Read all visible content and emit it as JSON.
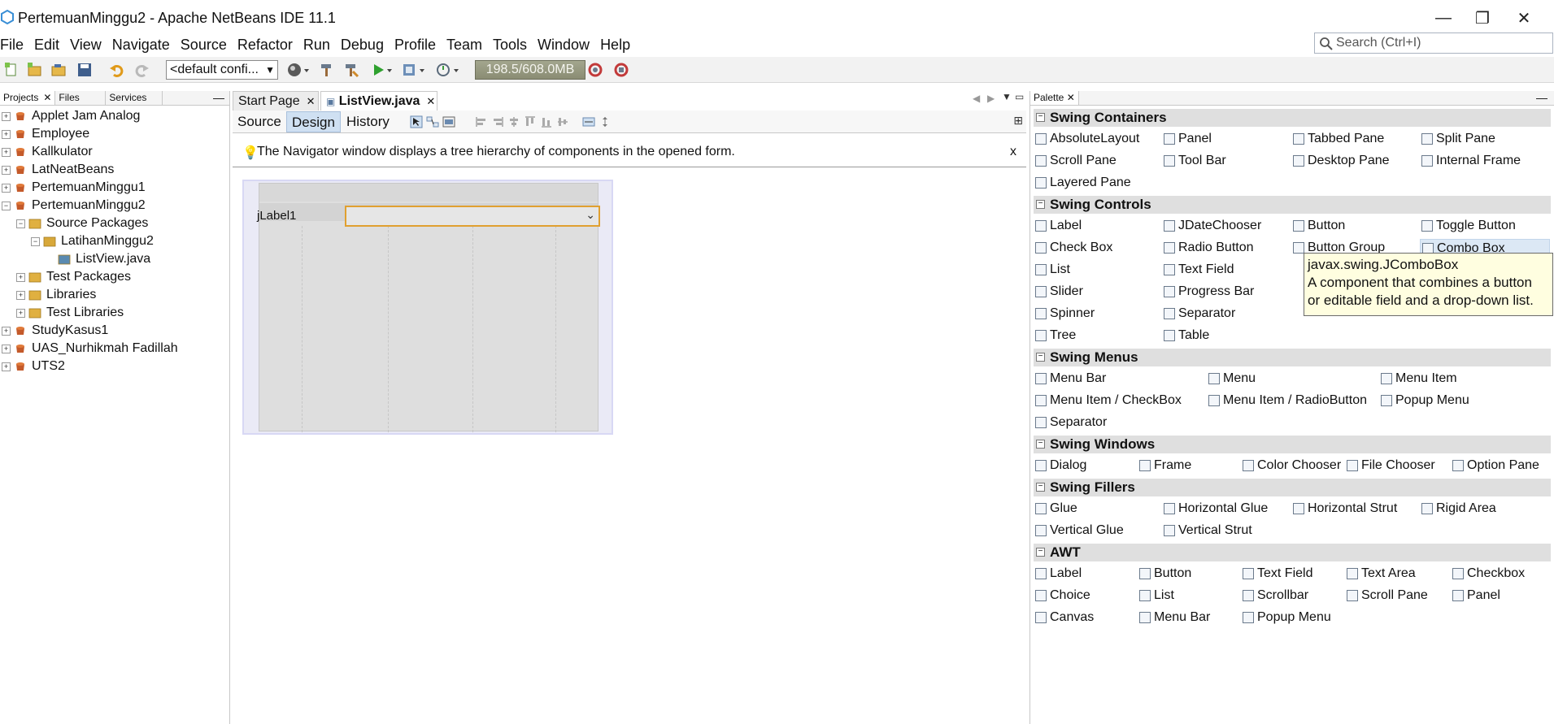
{
  "window": {
    "title": "PertemuanMinggu2 - Apache NetBeans IDE 11.1",
    "minimize": "—",
    "restore": "❐",
    "close": "✕"
  },
  "menu": [
    "File",
    "Edit",
    "View",
    "Navigate",
    "Source",
    "Refactor",
    "Run",
    "Debug",
    "Profile",
    "Team",
    "Tools",
    "Window",
    "Help"
  ],
  "search": {
    "placeholder": "Search (Ctrl+I)"
  },
  "toolbar": {
    "config": "<default confi...",
    "memory": "198.5/608.0MB"
  },
  "projects_panel": {
    "tabs": [
      "Projects",
      "Files",
      "Services"
    ],
    "tree": [
      {
        "label": "Applet Jam Analog",
        "level": 0,
        "expander": "+",
        "icon": "project-icon"
      },
      {
        "label": "Employee",
        "level": 0,
        "expander": "+",
        "icon": "project-icon"
      },
      {
        "label": "Kallkulator",
        "level": 0,
        "expander": "+",
        "icon": "project-icon"
      },
      {
        "label": "LatNeatBeans",
        "level": 0,
        "expander": "+",
        "icon": "project-icon"
      },
      {
        "label": "PertemuanMinggu1",
        "level": 0,
        "expander": "+",
        "icon": "project-icon"
      },
      {
        "label": "PertemuanMinggu2",
        "level": 0,
        "expander": "−",
        "icon": "project-icon"
      },
      {
        "label": "Source Packages",
        "level": 1,
        "expander": "−",
        "icon": "folder-icon"
      },
      {
        "label": "LatihanMinggu2",
        "level": 2,
        "expander": "−",
        "icon": "package-icon"
      },
      {
        "label": "ListView.java",
        "level": 3,
        "expander": "",
        "icon": "java-form-icon"
      },
      {
        "label": "Test Packages",
        "level": 1,
        "expander": "+",
        "icon": "folder-icon"
      },
      {
        "label": "Libraries",
        "level": 1,
        "expander": "+",
        "icon": "folder-icon"
      },
      {
        "label": "Test Libraries",
        "level": 1,
        "expander": "+",
        "icon": "folder-icon"
      },
      {
        "label": "StudyKasus1",
        "level": 0,
        "expander": "+",
        "icon": "project-icon"
      },
      {
        "label": "UAS_Nurhikmah Fadillah",
        "level": 0,
        "expander": "+",
        "icon": "project-icon"
      },
      {
        "label": "UTS2",
        "level": 0,
        "expander": "+",
        "icon": "project-icon"
      }
    ]
  },
  "editor": {
    "tabs": [
      {
        "label": "Start Page",
        "active": false
      },
      {
        "label": "ListView.java",
        "active": true
      }
    ],
    "views": [
      "Source",
      "Design",
      "History"
    ],
    "active_view": "Design",
    "info_message": "The Navigator window displays a tree hierarchy of components in the opened form.",
    "info_close": "x",
    "form": {
      "label": "jLabel1",
      "combo_arrow": "⌄"
    }
  },
  "palette": {
    "title": "Palette",
    "categories": [
      {
        "name": "Swing Containers",
        "items": [
          [
            "AbsoluteLayout",
            "Panel",
            "Tabbed Pane",
            "Split Pane"
          ],
          [
            "Scroll Pane",
            "Tool Bar",
            "Desktop Pane",
            "Internal Frame"
          ],
          [
            "Layered Pane"
          ]
        ]
      },
      {
        "name": "Swing Controls",
        "items": [
          [
            "Label",
            "JDateChooser",
            "Button",
            "Toggle Button"
          ],
          [
            "Check Box",
            "Radio Button",
            "Button Group",
            "Combo Box"
          ],
          [
            "List",
            "Text Field",
            "",
            ""
          ],
          [
            "Slider",
            "Progress Bar",
            "",
            ""
          ],
          [
            "Spinner",
            "Separator",
            "",
            ""
          ],
          [
            "Tree",
            "Table"
          ]
        ]
      },
      {
        "name": "Swing Menus",
        "items": [
          [
            "Menu Bar",
            "Menu",
            "Menu Item"
          ],
          [
            "Menu Item / CheckBox",
            "Menu Item / RadioButton",
            "Popup Menu"
          ],
          [
            "Separator"
          ]
        ]
      },
      {
        "name": "Swing Windows",
        "items": [
          [
            "Dialog",
            "Frame",
            "Color Chooser",
            "File Chooser",
            "Option Pane"
          ]
        ]
      },
      {
        "name": "Swing Fillers",
        "items": [
          [
            "Glue",
            "Horizontal Glue",
            "Horizontal Strut",
            "Rigid Area"
          ],
          [
            "Vertical Glue",
            "Vertical Strut"
          ]
        ]
      },
      {
        "name": "AWT",
        "items": [
          [
            "Label",
            "Button",
            "Text Field",
            "Text Area",
            "Checkbox"
          ],
          [
            "Choice",
            "List",
            "Scrollbar",
            "Scroll Pane",
            "Panel"
          ],
          [
            "Canvas",
            "Menu Bar",
            "Popup Menu"
          ]
        ]
      }
    ],
    "tooltip": {
      "line1": "javax.swing.JComboBox",
      "line2": "A component that combines a button",
      "line3": "or editable field and a drop-down list."
    }
  }
}
